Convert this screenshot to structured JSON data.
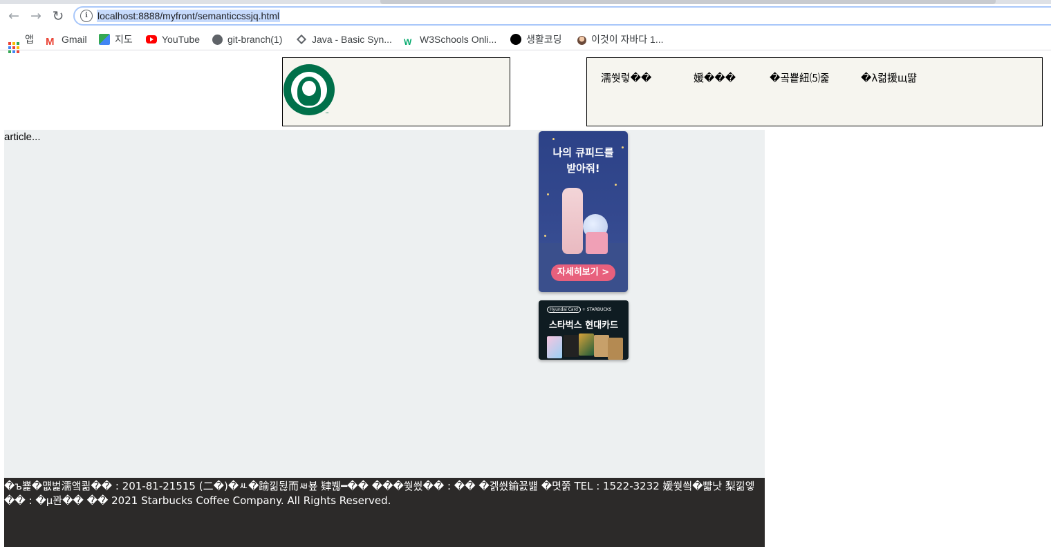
{
  "browser": {
    "url": "localhost:8888/myfront/semanticcssjq.html",
    "bookmarks": [
      {
        "label": "앱",
        "icon": "apps-grid-icon"
      },
      {
        "label": "Gmail",
        "icon": "gmail-icon"
      },
      {
        "label": "지도",
        "icon": "maps-icon"
      },
      {
        "label": "YouTube",
        "icon": "youtube-icon"
      },
      {
        "label": "git-branch(1)",
        "icon": "globe-icon"
      },
      {
        "label": "Java - Basic Syn...",
        "icon": "diamond-icon"
      },
      {
        "label": "W3Schools Onli...",
        "icon": "w3schools-icon"
      },
      {
        "label": "생활코딩",
        "icon": "black-circle-icon"
      },
      {
        "label": "이것이 자바다 1...",
        "icon": "avatar-icon"
      }
    ]
  },
  "header": {
    "logo_tm": "™",
    "nav": [
      "濡쒓렇��",
      "媛���",
      "�곸뿉紐⑸줉",
      "�λ컮援щ땲"
    ]
  },
  "article": {
    "text": "article..."
  },
  "aside": {
    "banner1": {
      "line1": "나의 큐피드를",
      "line2": "받아줘!",
      "button": "자세히보기 >"
    },
    "banner2": {
      "brand_left": "Hyundai Card",
      "brand_right": "+ STARBUCKS",
      "title": "스타벅스 현대카드"
    }
  },
  "footer": {
    "text": "�ъ뾽�먮벑濡앸쾲�� : 201-81-21515 (二�)�ㅻ�踰낆뒪而ㅽ뵾 肄붾━�� ���쒖씠�� : �� �겕씠鍮꾨뱶 �몃쭑 TEL : 1522-3232 媛쒖씤�뺣낫 梨낆엫�� : �µ꽌�� �� 2021 Starbucks Coffee Company. All Rights Reserved."
  },
  "colors": {
    "starbucks_green": "#00704a",
    "header_bg": "#f6f5ef",
    "article_bg": "#edf0f1",
    "footer_bg": "#2c2a29"
  }
}
